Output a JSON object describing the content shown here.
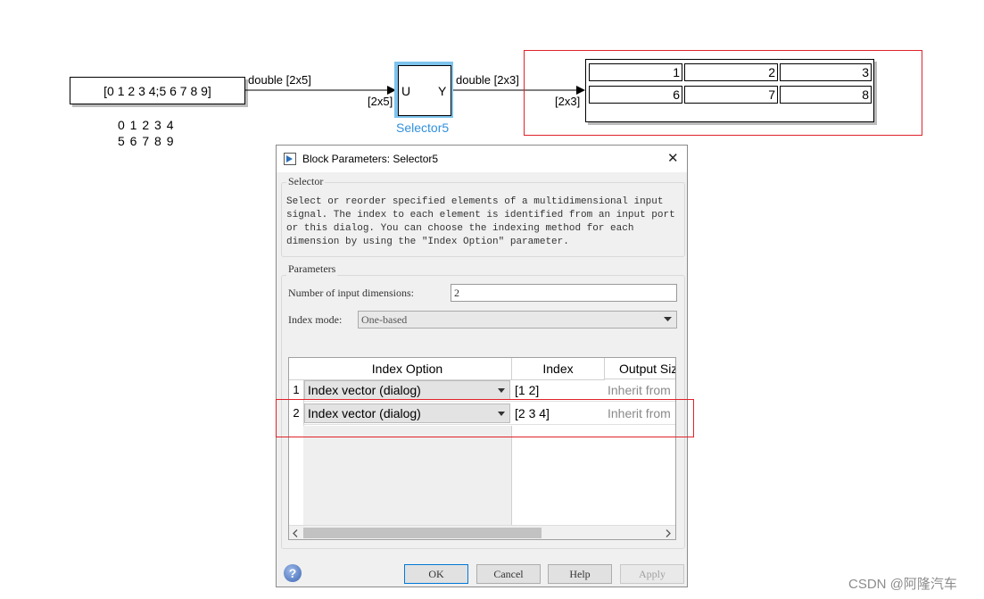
{
  "canvas": {
    "constant_block_value": "[0 1 2 3 4;5 6 7 8 9]",
    "signal1_label": "double [2x5]",
    "matrix_display": [
      "0 1 2 3 4",
      "5 6 7 8 9"
    ],
    "selector": {
      "in_port": "U",
      "out_port": "Y",
      "in_dim": "[2x5]",
      "name": "Selector5"
    },
    "signal2_label": "double [2x3]",
    "display_in_dim": "[2x3]",
    "display_values": [
      "1",
      "2",
      "3",
      "6",
      "7",
      "8"
    ]
  },
  "dialog": {
    "title": "Block Parameters: Selector5",
    "close_glyph": "✕",
    "group_selector": "Selector",
    "description": "Select or reorder specified elements of a multidimensional input signal. The index to each element is identified from an input port or this dialog. You can choose the indexing method for each dimension by using the \"Index Option\" parameter.",
    "group_parameters": "Parameters",
    "num_dims_label": "Number of input dimensions:",
    "num_dims_value": "2",
    "index_mode_label": "Index mode:",
    "index_mode_value": "One-based",
    "table": {
      "headers": [
        "Index Option",
        "Index",
        "Output Siz"
      ],
      "rows": [
        {
          "num": "1",
          "option": "Index vector (dialog)",
          "index": "[1 2]",
          "output": "Inherit from"
        },
        {
          "num": "2",
          "option": "Index vector (dialog)",
          "index": "[2 3 4]",
          "output": "Inherit from"
        }
      ]
    },
    "buttons": {
      "ok": "OK",
      "cancel": "Cancel",
      "help": "Help",
      "apply": "Apply"
    },
    "help_glyph": "?"
  },
  "watermark": "CSDN @阿隆汽车",
  "colors": {
    "highlight_red": "#e0222b",
    "selector_blue": "#3291de",
    "selection_outline": "#7ec3ee"
  }
}
